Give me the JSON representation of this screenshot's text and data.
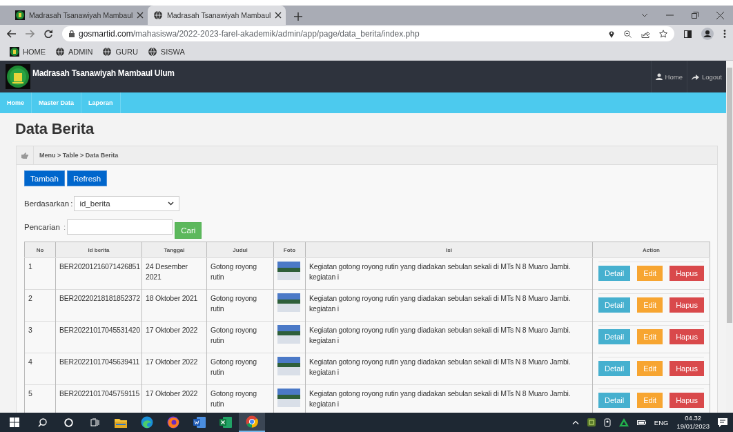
{
  "browser": {
    "tabs": [
      {
        "title": "Madrasah Tsanawiyah Mambaul",
        "selected": false
      },
      {
        "title": "Madrasah Tsanawiyah Mambaul",
        "selected": true
      }
    ],
    "url_host": "gosmartid.com",
    "url_path": "/mahasiswa/2022-2023-farel-akademik/admin/app/page/data_berita/index.php",
    "bookmarks": [
      {
        "label": "HOME"
      },
      {
        "label": "ADMIN"
      },
      {
        "label": "GURU"
      },
      {
        "label": "SISWA"
      }
    ]
  },
  "site": {
    "title": "Madrasah Tsanawiyah Mambaul Ulum",
    "header_links": [
      {
        "label": "Home"
      },
      {
        "label": "Logout"
      }
    ],
    "nav": [
      {
        "label": "Home"
      },
      {
        "label": "Master Data"
      },
      {
        "label": "Laporan"
      }
    ]
  },
  "page": {
    "heading": "Data Berita",
    "breadcrumb": "Menu > Table > Data Berita",
    "toolbar": [
      "Tambah",
      "Refresh"
    ],
    "filter": {
      "label": "Berdasarkan",
      "colon": ":",
      "value": "id_berita"
    },
    "search": {
      "label": "Pencarian",
      "colon": ":",
      "button": "Cari"
    },
    "table": {
      "columns": [
        "No",
        "Id berita",
        "Tanggal",
        "Judul",
        "Foto",
        "Isi",
        "Action"
      ],
      "rows": [
        {
          "no": "1",
          "id_berita": "BER20201216071426851",
          "tanggal": "24 Desember 2021",
          "judul": "Gotong royong rutin",
          "isi": "Kegiatan gotong royong rutin yang diadakan sebulan sekali di MTs N 8 Muaro Jambi. kegiatan i",
          "actions": [
            {
              "label": "Detail",
              "kind": "detail"
            },
            {
              "label": "Edit",
              "kind": "edit"
            },
            {
              "label": "Hapus",
              "kind": "delete"
            }
          ]
        },
        {
          "no": "2",
          "id_berita": "BER20220218181852372",
          "tanggal": "18 Oktober 2021",
          "judul": "Gotong royong rutin",
          "isi": "Kegiatan gotong royong rutin yang diadakan sebulan sekali di MTs N 8 Muaro Jambi. kegiatan i",
          "actions": [
            {
              "label": "Detail",
              "kind": "detail"
            },
            {
              "label": "Edit",
              "kind": "edit"
            },
            {
              "label": "Hapus",
              "kind": "delete"
            }
          ]
        },
        {
          "no": "3",
          "id_berita": "BER20221017045531420",
          "tanggal": "17 Oktober 2022",
          "judul": "Gotong royong rutin",
          "isi": "Kegiatan gotong royong rutin yang diadakan sebulan sekali di MTs N 8 Muaro Jambi. kegiatan i",
          "actions": [
            {
              "label": "Detail",
              "kind": "detail"
            },
            {
              "label": "Edit",
              "kind": "edit"
            },
            {
              "label": "Hapus",
              "kind": "delete"
            }
          ]
        },
        {
          "no": "4",
          "id_berita": "BER20221017045639411",
          "tanggal": "17 Oktober 2022",
          "judul": "Gotong royong rutin",
          "isi": "Kegiatan gotong royong rutin yang diadakan sebulan sekali di MTs N 8 Muaro Jambi. kegiatan i",
          "actions": [
            {
              "label": "Detail",
              "kind": "detail"
            },
            {
              "label": "Edit",
              "kind": "edit"
            },
            {
              "label": "Hapus",
              "kind": "delete"
            }
          ]
        },
        {
          "no": "5",
          "id_berita": "BER20221017045759115",
          "tanggal": "17 Oktober 2022",
          "judul": "Gotong royong rutin",
          "isi": "Kegiatan gotong royong rutin yang diadakan sebulan sekali di MTs N 8 Muaro Jambi. kegiatan i",
          "actions": [
            {
              "label": "Detail",
              "kind": "detail"
            },
            {
              "label": "Edit",
              "kind": "edit"
            },
            {
              "label": "Hapus",
              "kind": "delete"
            }
          ]
        }
      ]
    }
  },
  "taskbar": {
    "apps": [
      {
        "kind": "folder",
        "selected": false
      },
      {
        "kind": "edge",
        "selected": false
      },
      {
        "kind": "fox",
        "selected": false
      },
      {
        "kind": "document",
        "selected": false
      },
      {
        "kind": "sheet",
        "selected": false
      },
      {
        "kind": "chrome",
        "selected": true
      }
    ],
    "language": "ENG",
    "time": "04.32",
    "date": "19/01/2023"
  }
}
